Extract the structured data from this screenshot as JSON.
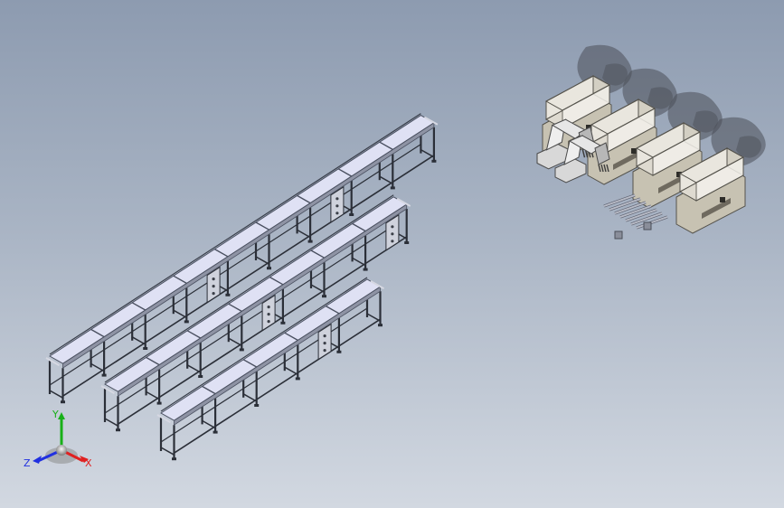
{
  "viewport": {
    "background_top": "#8d9bb0",
    "background_bottom": "#d2d8e1"
  },
  "model": {
    "conveyor_lines": 3,
    "modules_per_line": [
      9,
      7,
      5
    ],
    "packing_stations": 4,
    "robot_arms": 2,
    "pallets": 1
  },
  "colors": {
    "belt_top": "#dfe1f4",
    "belt_edge": "#4a5060",
    "frame": "#2b2f38",
    "machine_body": "#c7c2b2",
    "machine_top": "#dedad0",
    "machine_dark": "#6f6a5f",
    "shadow": "#4b4f58",
    "pallet": "#b9bcc7"
  },
  "triad": {
    "x_label": "X",
    "y_label": "Y",
    "z_label": "Z",
    "x_color": "#e02020",
    "y_color": "#18b018",
    "z_color": "#2030e0"
  }
}
